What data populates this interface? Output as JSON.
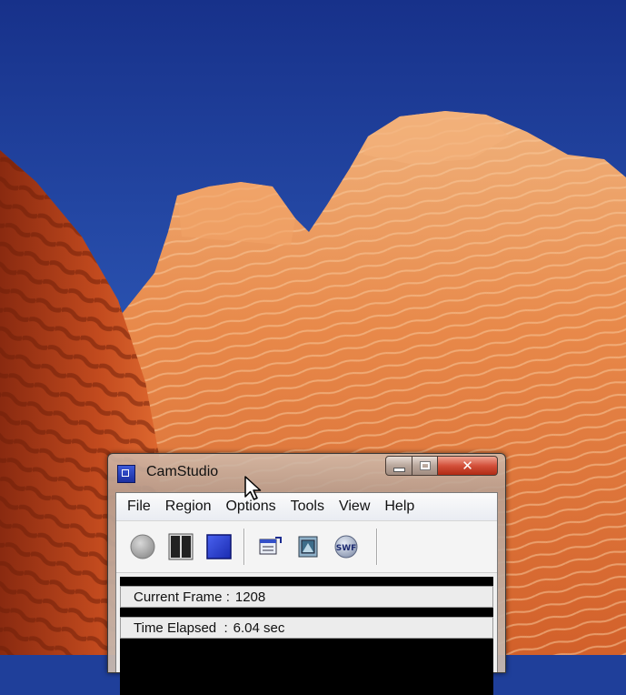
{
  "window": {
    "title": "CamStudio",
    "close_glyph": "✕"
  },
  "menu": {
    "items": [
      "File",
      "Region",
      "Options",
      "Tools",
      "View",
      "Help"
    ]
  },
  "toolbar": {
    "buttons": [
      "record-button",
      "pause-button",
      "stop-button",
      "toggle-view-button",
      "annotation-button",
      "swf-producer-button"
    ],
    "swf_label": "SWF"
  },
  "status": {
    "current_frame_label": "Current Frame :",
    "current_frame_value": "1208",
    "time_elapsed_label": "Time Elapsed  :",
    "time_elapsed_value": "6.04 sec"
  },
  "colors": {
    "sky": "#1f3f9a",
    "rock_orange": "#e0743a",
    "close_red": "#c8432c",
    "stop_blue": "#2a3fd0"
  }
}
